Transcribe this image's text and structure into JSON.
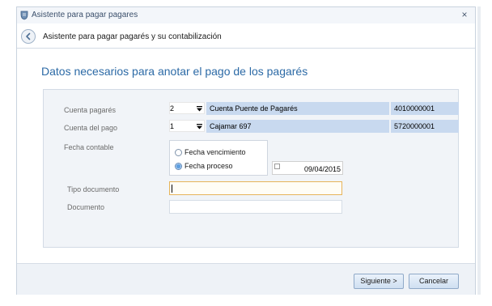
{
  "window": {
    "title": "Asistente para pagar pagares",
    "close_glyph": "×",
    "app_icon": "wallet-icon"
  },
  "header": {
    "text": "Asistente para pagar pagarés y su contabilización",
    "back_icon": "back-arrow-icon"
  },
  "section": {
    "title": "Datos necesarios para anotar el pago de los pagarés"
  },
  "form": {
    "cuenta_pagares": {
      "label": "Cuenta pagarés",
      "code": "2",
      "name": "Cuenta Puente de Pagarés",
      "account": "4010000001"
    },
    "cuenta_pago": {
      "label": "Cuenta del pago",
      "code": "1",
      "name": "Cajamar 697",
      "account": "5720000001"
    },
    "fecha_contable": {
      "label": "Fecha contable",
      "options": [
        {
          "label": "Fecha vencimiento",
          "selected": false
        },
        {
          "label": "Fecha proceso",
          "selected": true
        }
      ],
      "date": "09/04/2015"
    },
    "tipo_documento": {
      "label": "Tipo documento",
      "value": ""
    },
    "documento": {
      "label": "Documento",
      "value": ""
    }
  },
  "footer": {
    "next_label": "Siguiente >",
    "cancel_label": "Cancelar"
  },
  "colors": {
    "accent_title": "#2c6aa6",
    "readonly_fill": "#c8d9ef",
    "focus_border": "#e6b45a"
  }
}
